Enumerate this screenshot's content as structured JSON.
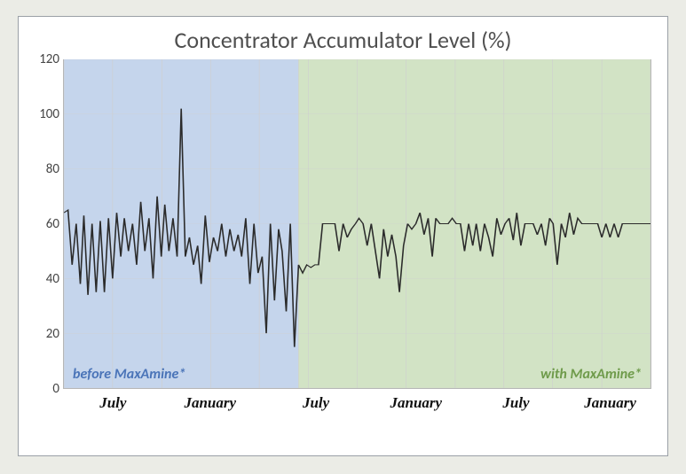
{
  "chart_data": {
    "type": "line",
    "title": "Concentrator Accumulator Level (%)",
    "ylim": [
      0,
      120
    ],
    "y_ticks": [
      0,
      20,
      40,
      60,
      80,
      100,
      120
    ],
    "x_ticks": [
      "July",
      "January",
      "July",
      "January",
      "July",
      "January"
    ],
    "x_tick_positions": [
      0.085,
      0.25,
      0.43,
      0.6,
      0.77,
      0.93
    ],
    "regions": [
      {
        "label": "before MaxAmine*",
        "color": "blue",
        "x0": 0.0,
        "x1": 0.4
      },
      {
        "label": "with MaxAmine*",
        "color": "green",
        "x0": 0.4,
        "x1": 1.0
      }
    ],
    "x": [
      0.0,
      0.007,
      0.014,
      0.021,
      0.028,
      0.034,
      0.041,
      0.048,
      0.055,
      0.062,
      0.069,
      0.076,
      0.083,
      0.09,
      0.097,
      0.103,
      0.11,
      0.117,
      0.124,
      0.131,
      0.138,
      0.145,
      0.152,
      0.159,
      0.166,
      0.172,
      0.179,
      0.186,
      0.193,
      0.2,
      0.207,
      0.214,
      0.221,
      0.228,
      0.234,
      0.241,
      0.248,
      0.255,
      0.262,
      0.269,
      0.276,
      0.283,
      0.29,
      0.297,
      0.303,
      0.31,
      0.317,
      0.324,
      0.331,
      0.338,
      0.345,
      0.352,
      0.359,
      0.366,
      0.372,
      0.379,
      0.386,
      0.393,
      0.4,
      0.407,
      0.414,
      0.421,
      0.428,
      0.434,
      0.441,
      0.448,
      0.455,
      0.462,
      0.469,
      0.476,
      0.483,
      0.49,
      0.497,
      0.503,
      0.51,
      0.517,
      0.524,
      0.531,
      0.538,
      0.545,
      0.552,
      0.559,
      0.566,
      0.572,
      0.579,
      0.586,
      0.593,
      0.6,
      0.607,
      0.614,
      0.621,
      0.628,
      0.634,
      0.641,
      0.648,
      0.655,
      0.662,
      0.669,
      0.676,
      0.683,
      0.69,
      0.697,
      0.703,
      0.71,
      0.717,
      0.724,
      0.731,
      0.738,
      0.745,
      0.752,
      0.759,
      0.766,
      0.772,
      0.779,
      0.786,
      0.793,
      0.8,
      0.807,
      0.814,
      0.821,
      0.828,
      0.834,
      0.841,
      0.848,
      0.855,
      0.862,
      0.869,
      0.876,
      0.883,
      0.89,
      0.897,
      0.903,
      0.91,
      0.917,
      0.924,
      0.931,
      0.938,
      0.945,
      0.952,
      0.959,
      0.966,
      0.972,
      0.979,
      0.986,
      0.993,
      1.0
    ],
    "values": [
      64,
      65,
      45,
      60,
      38,
      63,
      34,
      60,
      35,
      61,
      35,
      62,
      40,
      64,
      48,
      62,
      50,
      60,
      45,
      68,
      50,
      62,
      40,
      70,
      48,
      67,
      50,
      62,
      48,
      102,
      48,
      55,
      45,
      52,
      38,
      63,
      46,
      55,
      50,
      60,
      48,
      58,
      50,
      56,
      48,
      62,
      38,
      60,
      42,
      48,
      20,
      60,
      32,
      58,
      50,
      28,
      60,
      15,
      45,
      42,
      45,
      44,
      45,
      45,
      60,
      60,
      60,
      60,
      50,
      60,
      55,
      58,
      60,
      62,
      60,
      52,
      60,
      50,
      40,
      58,
      48,
      56,
      48,
      35,
      52,
      60,
      58,
      60,
      64,
      56,
      62,
      48,
      62,
      60,
      60,
      60,
      62,
      60,
      60,
      50,
      60,
      52,
      60,
      50,
      60,
      55,
      48,
      62,
      56,
      60,
      62,
      54,
      64,
      52,
      60,
      60,
      60,
      56,
      60,
      52,
      62,
      60,
      45,
      60,
      55,
      64,
      56,
      62,
      60,
      60,
      60,
      60,
      60,
      55,
      60,
      55,
      60,
      55,
      60,
      60,
      60,
      60,
      60,
      60,
      60,
      60
    ]
  }
}
